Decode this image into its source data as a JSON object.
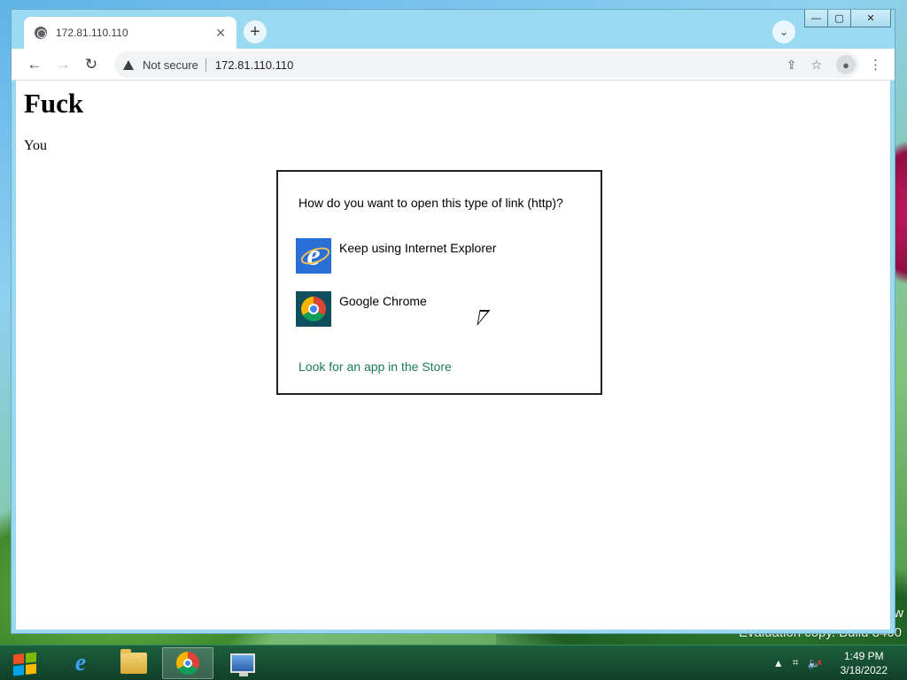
{
  "browser": {
    "tab_title": "172.81.110.110",
    "tab_close": "✕",
    "new_tab": "+",
    "tab_search": "⌄",
    "caption": {
      "minimize": "—",
      "maximize": "▢",
      "close": "✕"
    },
    "nav": {
      "back": "←",
      "forward": "→",
      "reload": "↻"
    },
    "omnibox": {
      "security_label": "Not secure",
      "url": "172.81.110.110",
      "share_icon": "share-icon",
      "bookmark": "☆"
    },
    "profile": "●",
    "menu": "⋮"
  },
  "page": {
    "heading": "Fuck",
    "paragraph": "You"
  },
  "dialog": {
    "title": "How do you want to open this type of link (http)?",
    "options": [
      {
        "label": "Keep using Internet Explorer",
        "icon": "internet-explorer-icon"
      },
      {
        "label": "Google Chrome",
        "icon": "google-chrome-icon"
      }
    ],
    "store_link": "Look for an app in the Store",
    "link_color": "#1a7a5e"
  },
  "desktop": {
    "watermark_line": "Evaluation copy. Build 8400",
    "watermark_fragment": "w"
  },
  "taskbar": {
    "pinned": [
      "internet-explorer-icon",
      "file-explorer-icon",
      "google-chrome-icon",
      "remote-desktop-icon"
    ],
    "active": "google-chrome-icon",
    "clock_time": "1:49 PM",
    "clock_date": "3/18/2022",
    "tray_chevron": "▲",
    "tray_network": "⌗",
    "tray_volume": "🔈",
    "tray_volume_muted": "x"
  }
}
